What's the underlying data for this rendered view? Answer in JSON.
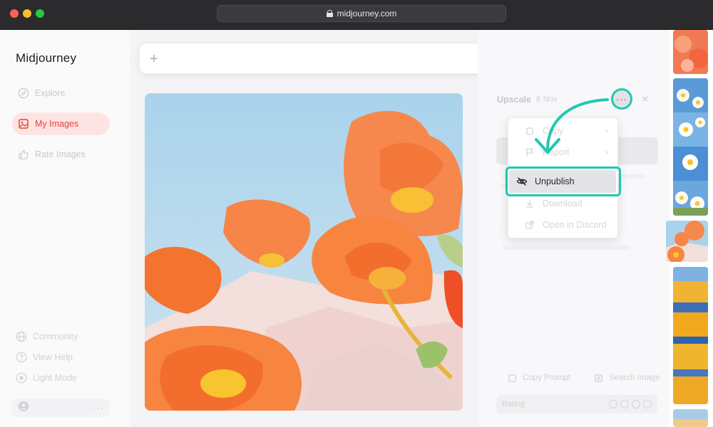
{
  "browser": {
    "url": "midjourney.com"
  },
  "sidebar": {
    "logo": "Midjourney",
    "items": [
      {
        "label": "Explore",
        "icon": "compass-icon",
        "active": false
      },
      {
        "label": "My Images",
        "icon": "image-icon",
        "active": true
      },
      {
        "label": "Rate Images",
        "icon": "thumbs-up-icon",
        "active": false
      }
    ],
    "bottom_items": [
      {
        "label": "Community",
        "icon": "globe-icon"
      },
      {
        "label": "View Help",
        "icon": "help-icon"
      },
      {
        "label": "Light Mode",
        "icon": "sun-icon"
      }
    ],
    "user_menu_dots": "···"
  },
  "prompt": {
    "plus_icon": "+",
    "settings_icon": "gear-icon"
  },
  "details": {
    "title": "Upscale",
    "date": "6 Nov",
    "more_button": "···",
    "close": "×"
  },
  "menu": {
    "items": [
      {
        "label": "Copy",
        "icon": "copy-icon",
        "submenu": true
      },
      {
        "label": "Report",
        "icon": "flag-icon",
        "submenu": true
      },
      {
        "label": "Unpublish",
        "icon": "eye-off-icon",
        "submenu": false
      },
      {
        "label": "Download",
        "icon": "download-icon",
        "submenu": false
      },
      {
        "label": "Open in Discord",
        "icon": "external-link-icon",
        "submenu": false
      }
    ],
    "chevron": "›"
  },
  "footer": {
    "copy_prompt": "Copy Prompt",
    "search_image": "Search Image",
    "rating_label": "Rating"
  },
  "colors": {
    "accent": "#e4413c",
    "highlight": "#21c8b0",
    "active_bg": "#fde4e3"
  }
}
